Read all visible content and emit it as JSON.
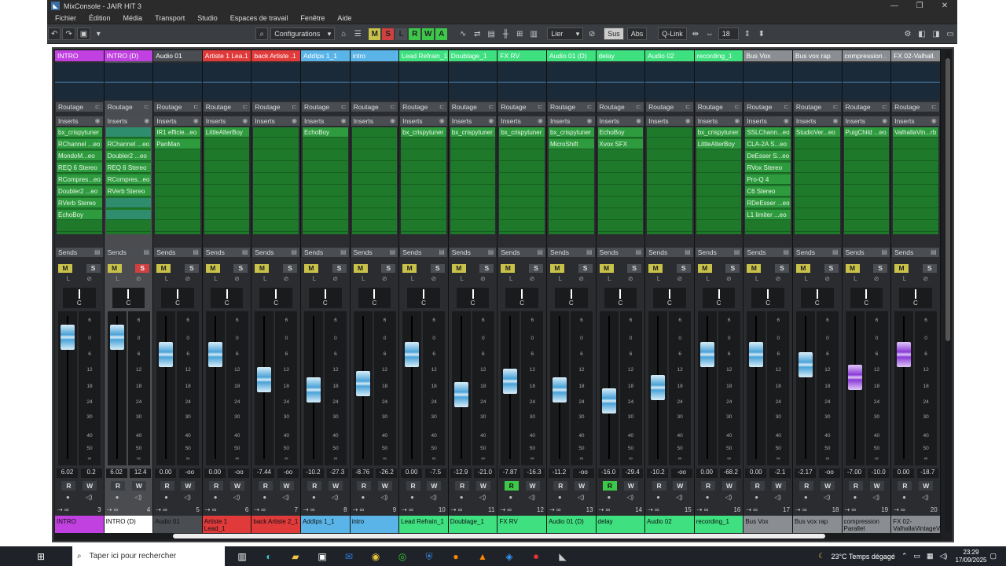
{
  "window": {
    "title": "MixConsole - JAIR HIT 3"
  },
  "menu": [
    "Fichier",
    "Édition",
    "Média",
    "Transport",
    "Studio",
    "Espaces de travail",
    "Fenêtre",
    "Aide"
  ],
  "toolbar": {
    "config_label": "Configurations",
    "lier": "Lier",
    "sus": "Sus",
    "abs": "Abs",
    "qlink": "Q-Link",
    "count": "18",
    "msb": [
      {
        "l": "M",
        "c": "#c9c24a"
      },
      {
        "l": "S",
        "c": "#d04040"
      },
      {
        "l": "L",
        "c": "#4a4d52"
      },
      {
        "l": "R",
        "c": "#3ec84a"
      },
      {
        "l": "W",
        "c": "#3ec84a"
      },
      {
        "l": "A",
        "c": "#3ec84a"
      }
    ]
  },
  "section_labels": {
    "routage": "Routage",
    "inserts": "Inserts",
    "sends": "Sends"
  },
  "channels": [
    {
      "name": "INTRO",
      "color": "#c040e0",
      "sel": false,
      "inserts": [
        "bx_crispytuner",
        "RChannel ...eo",
        "MondoM...eo",
        "REQ 6 Stereo",
        "RCompres...eo",
        "Doubler2 ...eo",
        "RVerb Stereo",
        "EchoBoy"
      ],
      "solo": false,
      "fader": 0.92,
      "v1": "6.02",
      "v2": "0.2",
      "r_on": false,
      "num": "3",
      "purple": false,
      "bot": "INTRO",
      "botcolor": "#c040e0"
    },
    {
      "name": "INTRO (D)",
      "color": "#c040e0",
      "sel": true,
      "inserts": [
        "",
        "RChannel ...eo",
        "Doubler2 ...eo",
        "REQ 6 Stereo",
        "RCompres...eo",
        "RVerb Stereo",
        "",
        ""
      ],
      "solo": true,
      "fader": 0.92,
      "v1": "6.02",
      "v2": "12.4",
      "r_on": false,
      "num": "4",
      "purple": false,
      "bot": "INTRO (D)",
      "botcolor": "#ffffff"
    },
    {
      "name": "Audio 01",
      "color": "#4a4d52",
      "sel": false,
      "inserts": [
        "IR1 efficie...eo",
        "PanMan"
      ],
      "solo": false,
      "fader": 0.78,
      "v1": "0.00",
      "v2": "-oo",
      "r_on": false,
      "num": "5",
      "purple": false,
      "bot": "Audio 01",
      "botcolor": "#4a4d52"
    },
    {
      "name": "Artiste 1 Lea.1",
      "color": "#e03a3a",
      "sel": false,
      "inserts": [
        "LittleAlterBoy"
      ],
      "solo": false,
      "fader": 0.78,
      "v1": "0.00",
      "v2": "-oo",
      "r_on": false,
      "num": "6",
      "purple": false,
      "bot": "Artiste 1 Lead_1",
      "botcolor": "#e03a3a"
    },
    {
      "name": "back Artiste .1",
      "color": "#e03a3a",
      "sel": false,
      "inserts": [],
      "solo": false,
      "fader": 0.58,
      "v1": "-7.44",
      "v2": "-oo",
      "r_on": false,
      "num": "7",
      "purple": false,
      "bot": "back Artiste 2_1",
      "botcolor": "#e03a3a"
    },
    {
      "name": "AddIps 1_1",
      "color": "#5ab4e8",
      "sel": false,
      "inserts": [
        "EchoBoy"
      ],
      "solo": false,
      "fader": 0.5,
      "v1": "-10.2",
      "v2": "-27.3",
      "r_on": false,
      "num": "8",
      "purple": false,
      "bot": "AddIps 1_1",
      "botcolor": "#5ab4e8"
    },
    {
      "name": "intro",
      "color": "#5ab4e8",
      "sel": false,
      "inserts": [],
      "solo": false,
      "fader": 0.55,
      "v1": "-8.76",
      "v2": "-26.2",
      "r_on": false,
      "num": "9",
      "purple": false,
      "bot": "intro",
      "botcolor": "#5ab4e8"
    },
    {
      "name": "Lead Refrain_1",
      "color": "#3ee080",
      "sel": false,
      "inserts": [
        "bx_crispytuner"
      ],
      "solo": false,
      "fader": 0.78,
      "v1": "0.00",
      "v2": "-7.5",
      "r_on": false,
      "num": "10",
      "purple": false,
      "bot": "Lead Refrain_1",
      "botcolor": "#3ee080"
    },
    {
      "name": "Doublage_1",
      "color": "#3ee080",
      "sel": false,
      "inserts": [
        "bx_crispytuner"
      ],
      "solo": false,
      "fader": 0.46,
      "v1": "-12.9",
      "v2": "-21.0",
      "r_on": false,
      "num": "11",
      "purple": false,
      "bot": "Doublage_1",
      "botcolor": "#3ee080"
    },
    {
      "name": "FX RV",
      "color": "#3ee080",
      "sel": false,
      "inserts": [
        "bx_crispytuner"
      ],
      "solo": false,
      "fader": 0.57,
      "v1": "-7.87",
      "v2": "-16.3",
      "r_on": true,
      "num": "12",
      "purple": false,
      "bot": "FX RV",
      "botcolor": "#3ee080"
    },
    {
      "name": "Audio 01 (D)",
      "color": "#3ee080",
      "sel": false,
      "inserts": [
        "bx_crispytuner",
        "MicroShift"
      ],
      "solo": false,
      "fader": 0.5,
      "v1": "-11.2",
      "v2": "-oo",
      "r_on": false,
      "num": "13",
      "purple": false,
      "bot": "Audio 01 (D)",
      "botcolor": "#3ee080"
    },
    {
      "name": "delay",
      "color": "#3ee080",
      "sel": false,
      "inserts": [
        "EchoBoy",
        "Xvox SFX"
      ],
      "solo": false,
      "fader": 0.41,
      "v1": "-16.0",
      "v2": "-29.4",
      "r_on": true,
      "num": "14",
      "purple": false,
      "bot": "delay",
      "botcolor": "#3ee080"
    },
    {
      "name": "Audio 02",
      "color": "#3ee080",
      "sel": false,
      "inserts": [],
      "solo": false,
      "fader": 0.52,
      "v1": "-10.2",
      "v2": "-oo",
      "r_on": false,
      "num": "15",
      "purple": false,
      "bot": "Audio 02",
      "botcolor": "#3ee080"
    },
    {
      "name": "recording_1",
      "color": "#3ee080",
      "sel": false,
      "inserts": [
        "bx_crispytuner",
        "LittleAlterBoy"
      ],
      "solo": false,
      "fader": 0.78,
      "v1": "0.00",
      "v2": "-68.2",
      "r_on": false,
      "num": "16",
      "purple": false,
      "bot": "recording_1",
      "botcolor": "#3ee080"
    },
    {
      "name": "Bus Vox",
      "color": "#8a8d92",
      "sel": false,
      "inserts": [
        "SSLChann...eo",
        "CLA-2A S...eo",
        "DeEsser S...eo",
        "RVox Stereo",
        "Pro-Q 4",
        "C6 Stereo",
        "RDeEsser ...eo",
        "L1 limiter ...eo"
      ],
      "solo": false,
      "fader": 0.78,
      "v1": "0.00",
      "v2": "-2.1",
      "r_on": false,
      "num": "17",
      "purple": false,
      "bot": "Bus Vox",
      "botcolor": "#8a8d92"
    },
    {
      "name": "Bus vox rap",
      "color": "#8a8d92",
      "sel": false,
      "inserts": [
        "StudioVer...eo"
      ],
      "solo": false,
      "fader": 0.7,
      "v1": "-2.17",
      "v2": "-oo",
      "r_on": false,
      "num": "18",
      "purple": false,
      "bot": "Bus vox rap",
      "botcolor": "#8a8d92"
    },
    {
      "name": "compression .",
      "color": "#8a8d92",
      "sel": false,
      "inserts": [
        "PuigChild ...eo"
      ],
      "solo": false,
      "fader": 0.6,
      "v1": "-7.00",
      "v2": "-10.0",
      "r_on": false,
      "num": "19",
      "purple": true,
      "bot": "compression Parallel",
      "botcolor": "#8a8d92"
    },
    {
      "name": "FX 02-Valhall.",
      "color": "#8a8d92",
      "sel": false,
      "inserts": [
        "ValhallaVin...rb"
      ],
      "solo": false,
      "fader": 0.78,
      "v1": "0.00",
      "v2": "-18.7",
      "r_on": false,
      "num": "20",
      "purple": true,
      "bot": "FX 02-ValhallaVintageV",
      "botcolor": "#8a8d92"
    }
  ],
  "scale": [
    "6",
    "0",
    "6",
    "12",
    "18",
    "24",
    "30",
    "40",
    "50",
    "∞"
  ],
  "scale_r": [
    "6",
    "0",
    "6",
    "12",
    "18",
    "24",
    "30",
    "40",
    "50",
    "00"
  ],
  "taskbar": {
    "search_placeholder": "Taper ici pour rechercher",
    "weather": "23°C  Temps dégagé",
    "time": "23:29",
    "date": "17/09/2025"
  }
}
